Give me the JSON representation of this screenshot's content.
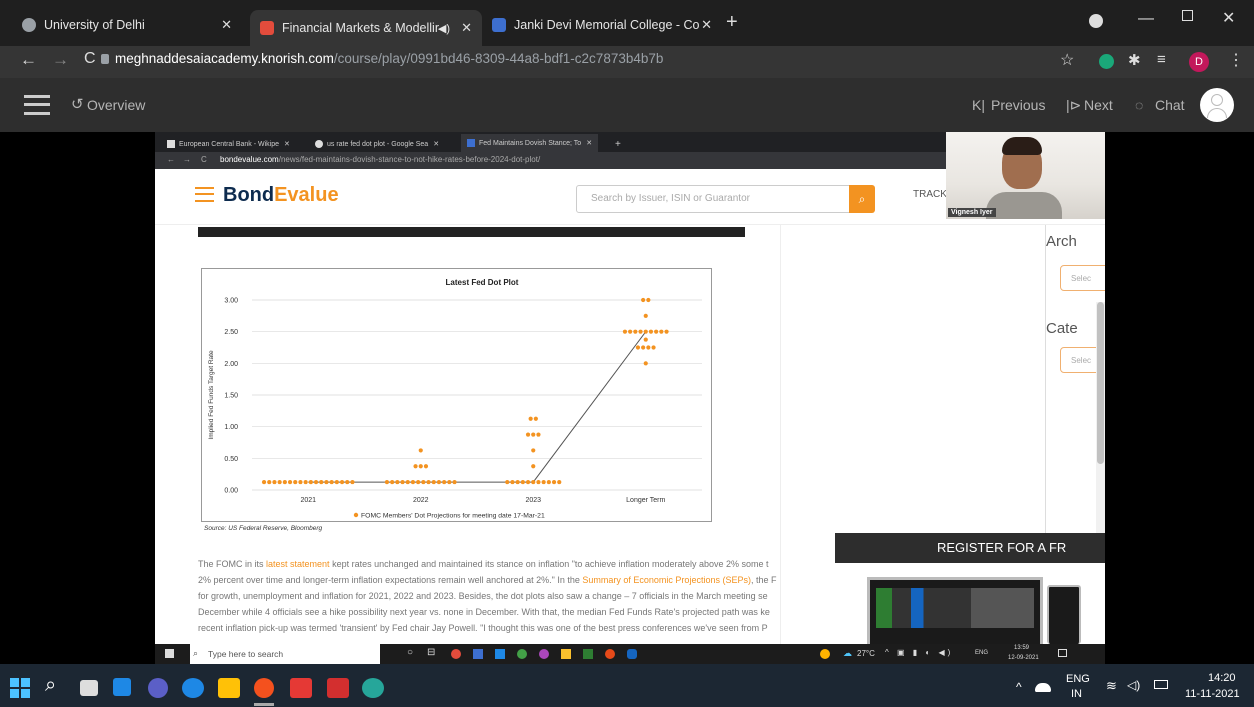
{
  "browser": {
    "tabs": [
      {
        "title": "University of Delhi",
        "color": "#9aa0a6"
      },
      {
        "title": "Financial Markets & Modellir",
        "color": "#e34c3c"
      },
      {
        "title": "Janki Devi Memorial College - Co",
        "color": "#3d6fd0"
      }
    ],
    "new_tab": "+",
    "url_domain": "meghnaddesaiacademy.knorish.com",
    "url_path": "/course/play/0991bd46-8309-44a8-bdf1-c2c7873b4b7b",
    "profile_initial": "D"
  },
  "lms": {
    "overview": "Overview",
    "previous": "Previous",
    "next": "Next",
    "chat": "Chat"
  },
  "inner_browser": {
    "tabs": [
      "European Central Bank - Wikipe",
      "us rate fed dot plot - Google Sea",
      "Fed Maintains Dovish Stance; To"
    ],
    "url_domain": "bondevalue.com",
    "url_path": "/news/fed-maintains-dovish-stance-to-not-hike-rates-before-2024-dot-plot/"
  },
  "site": {
    "logo_a": "Bond",
    "logo_b": "Evalue",
    "search_placeholder": "Search by Issuer, ISIN or Guarantor",
    "track": "TRACK",
    "sidebar": [
      "Arch",
      "Selec",
      "Cate",
      "Selec"
    ],
    "source": "Source: US Federal Reserve, Bloomberg",
    "paragraph": [
      {
        "a": "The FOMC in its ",
        "b": "latest statement",
        "c": " kept rates unchanged and maintained its stance on inflation \"to achieve inflation moderately above 2% some t"
      },
      {
        "a": "2% percent over time and longer-term inflation expectations remain well anchored at 2%.\" In the ",
        "b": "Summary of Economic Projections (SEPs)",
        "c": ", the F"
      },
      {
        "a": "for growth, unemployment and inflation for 2021, 2022 and 2023. Besides, the dot plots also saw a change – 7 officials in the March meeting se",
        "b": "",
        "c": ""
      },
      {
        "a": "December while 4 officials see a hike possibility next year vs. none in December. With that, the median Fed Funds Rate's projected path was ke",
        "b": "",
        "c": ""
      },
      {
        "a": "recent inflation pick-up was termed 'transient' by Fed chair Jay Powell. \"I thought this was one of the best press conferences we've seen from P",
        "b": "",
        "c": ""
      }
    ],
    "register": "REGISTER FOR A FR"
  },
  "video": {
    "name": "Vignesh Iyer"
  },
  "chart_data": {
    "type": "scatter",
    "title": "Latest Fed Dot Plot",
    "ylabel": "Implied Fed Funds Target Rate",
    "xlabel": "",
    "categories": [
      "2021",
      "2022",
      "2023",
      "Longer Term"
    ],
    "yticks": [
      "3.00",
      "2.50",
      "2.00",
      "1.50",
      "1.00",
      "0.50",
      "0.00"
    ],
    "ylim": [
      0,
      3
    ],
    "grid": true,
    "legend": "FOMC Members' Dot Projections for meeting date 17-Mar-21",
    "legend_position": "bottom",
    "dot_color": "#f39321",
    "median_line": [
      {
        "x": "2021",
        "y": 0.125
      },
      {
        "x": "2022",
        "y": 0.125
      },
      {
        "x": "2023",
        "y": 0.125
      },
      {
        "x": "Longer Term",
        "y": 2.5
      }
    ],
    "series": [
      {
        "levels": [
          {
            "category": "2021",
            "y": 0.125,
            "count": 18
          }
        ]
      },
      {
        "levels": [
          {
            "category": "2022",
            "y": 0.625,
            "count": 1
          },
          {
            "category": "2022",
            "y": 0.375,
            "count": 3
          },
          {
            "category": "2022",
            "y": 0.125,
            "count": 14
          }
        ]
      },
      {
        "levels": [
          {
            "category": "2023",
            "y": 1.125,
            "count": 2
          },
          {
            "category": "2023",
            "y": 0.875,
            "count": 3
          },
          {
            "category": "2023",
            "y": 0.625,
            "count": 1
          },
          {
            "category": "2023",
            "y": 0.375,
            "count": 1
          },
          {
            "category": "2023",
            "y": 0.125,
            "count": 11
          }
        ]
      },
      {
        "levels": [
          {
            "category": "Longer Term",
            "y": 3.0,
            "count": 2
          },
          {
            "category": "Longer Term",
            "y": 2.75,
            "count": 1
          },
          {
            "category": "Longer Term",
            "y": 2.5,
            "count": 9
          },
          {
            "category": "Longer Term",
            "y": 2.375,
            "count": 1
          },
          {
            "category": "Longer Term",
            "y": 2.25,
            "count": 4
          },
          {
            "category": "Longer Term",
            "y": 2.0,
            "count": 1
          }
        ]
      }
    ]
  },
  "inner_taskbar": {
    "search": "Type here to search",
    "weather": "27°C",
    "lang": "ENG",
    "time": "13:59",
    "date": "12-09-2021"
  },
  "taskbar": {
    "lang1": "ENG",
    "lang2": "IN",
    "time": "14:20",
    "date": "11-11-2021"
  }
}
